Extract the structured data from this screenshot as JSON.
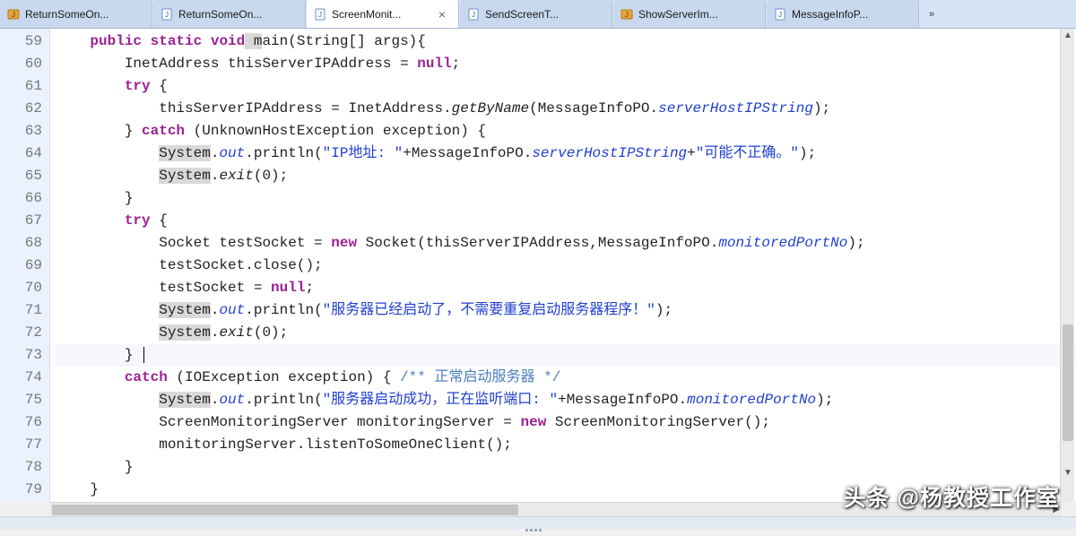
{
  "tabs": [
    {
      "label": "ReturnSomeOn...",
      "icon": "java-unit",
      "active": false
    },
    {
      "label": "ReturnSomeOn...",
      "icon": "java-file",
      "active": false
    },
    {
      "label": "ScreenMonit...",
      "icon": "java-file",
      "active": true
    },
    {
      "label": "SendScreenT...",
      "icon": "java-file",
      "active": false
    },
    {
      "label": "ShowServerIm...",
      "icon": "java-unit",
      "active": false
    },
    {
      "label": "MessageInfoP...",
      "icon": "java-file",
      "active": false
    }
  ],
  "overflow_glyph": "»",
  "line_start": 59,
  "line_end": 79,
  "cursor_line": 73,
  "code": {
    "l59": {
      "indent": "    ",
      "t": [
        "public",
        " ",
        "static",
        " ",
        "void",
        " m",
        "ain(String[] args){"
      ]
    },
    "l60": {
      "indent": "        ",
      "t": [
        "InetAddress thisServerIPAddress = ",
        "null",
        ";"
      ]
    },
    "l61": {
      "indent": "        ",
      "t": [
        "try",
        " {"
      ]
    },
    "l62": {
      "indent": "            ",
      "t": [
        "thisServerIPAddress = InetAddress.",
        "getByName",
        "(MessageInfoPO.",
        "serverHostIPString",
        ");"
      ]
    },
    "l63": {
      "indent": "        ",
      "t": [
        "} ",
        "catch",
        " (UnknownHostException exception) {"
      ]
    },
    "l64": {
      "indent": "            ",
      "t": [
        "System",
        ".",
        "out",
        ".println(",
        "\"IP地址: \"",
        "+MessageInfoPO.",
        "serverHostIPString",
        "+",
        "\"可能不正确。\"",
        ");"
      ]
    },
    "l65": {
      "indent": "            ",
      "t": [
        "System",
        ".",
        "exit",
        "(0);"
      ]
    },
    "l66": {
      "indent": "        ",
      "t": [
        "}"
      ]
    },
    "l67": {
      "indent": "        ",
      "t": [
        "try",
        " {"
      ]
    },
    "l68": {
      "indent": "            ",
      "t": [
        "Socket testSocket = ",
        "new",
        " Socket(thisServerIPAddress,MessageInfoPO.",
        "monitoredPortNo",
        ");"
      ]
    },
    "l69": {
      "indent": "            ",
      "t": [
        "testSocket.close();"
      ]
    },
    "l70": {
      "indent": "            ",
      "t": [
        "testSocket = ",
        "null",
        ";"
      ]
    },
    "l71": {
      "indent": "            ",
      "t": [
        "System",
        ".",
        "out",
        ".println(",
        "\"服务器已经启动了，不需要重复启动服务器程序！\"",
        ");"
      ]
    },
    "l72": {
      "indent": "            ",
      "t": [
        "System",
        ".",
        "exit",
        "(0);"
      ]
    },
    "l73": {
      "indent": "        ",
      "t": [
        "}"
      ]
    },
    "l74": {
      "indent": "        ",
      "t": [
        "catch",
        " (IOException exception) { ",
        "/** 正常启动服务器 */"
      ]
    },
    "l75": {
      "indent": "            ",
      "t": [
        "System",
        ".",
        "out",
        ".println(",
        "\"服务器启动成功，正在监听端口: \"",
        "+MessageInfoPO.",
        "monitoredPortNo",
        ");"
      ]
    },
    "l76": {
      "indent": "            ",
      "t": [
        "ScreenMonitoringServer monitoringServer = ",
        "new",
        " ScreenMonitoringServer();"
      ]
    },
    "l77": {
      "indent": "            ",
      "t": [
        "monitoringServer.listenToSomeOneClient();"
      ]
    },
    "l78": {
      "indent": "        ",
      "t": [
        "}"
      ]
    },
    "l79": {
      "indent": "    ",
      "t": [
        "}"
      ]
    }
  },
  "watermark": "头条 @杨教授工作室"
}
